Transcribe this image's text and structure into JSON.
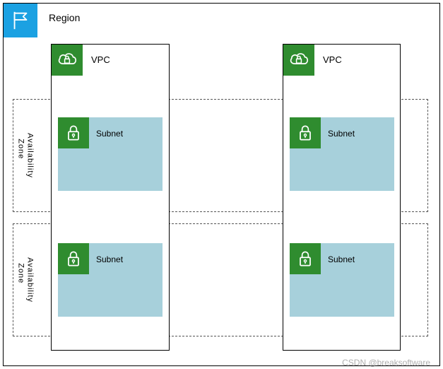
{
  "region": {
    "label": "Region"
  },
  "vpc": {
    "left": {
      "label": "VPC"
    },
    "right": {
      "label": "VPC"
    }
  },
  "az": {
    "row1": {
      "label": "Availability\n  Zone"
    },
    "row2": {
      "label": "Availability\n  Zone"
    }
  },
  "subnet": {
    "top_left": {
      "label": "Subnet"
    },
    "top_right": {
      "label": "Subnet"
    },
    "bottom_left": {
      "label": "Subnet"
    },
    "bottom_right": {
      "label": "Subnet"
    }
  },
  "watermark": "CSDN @breaksoftware",
  "chart_data": {
    "type": "diagram",
    "title": "AWS Region / VPC / Availability Zone / Subnet layout",
    "region": {
      "vpcs": [
        {
          "name": "VPC",
          "subnets": [
            "Subnet",
            "Subnet"
          ],
          "spans_zones": [
            "Availability Zone",
            "Availability Zone"
          ]
        },
        {
          "name": "VPC",
          "subnets": [
            "Subnet",
            "Subnet"
          ],
          "spans_zones": [
            "Availability Zone",
            "Availability Zone"
          ]
        }
      ],
      "availability_zones": [
        "Availability Zone",
        "Availability Zone"
      ]
    }
  }
}
